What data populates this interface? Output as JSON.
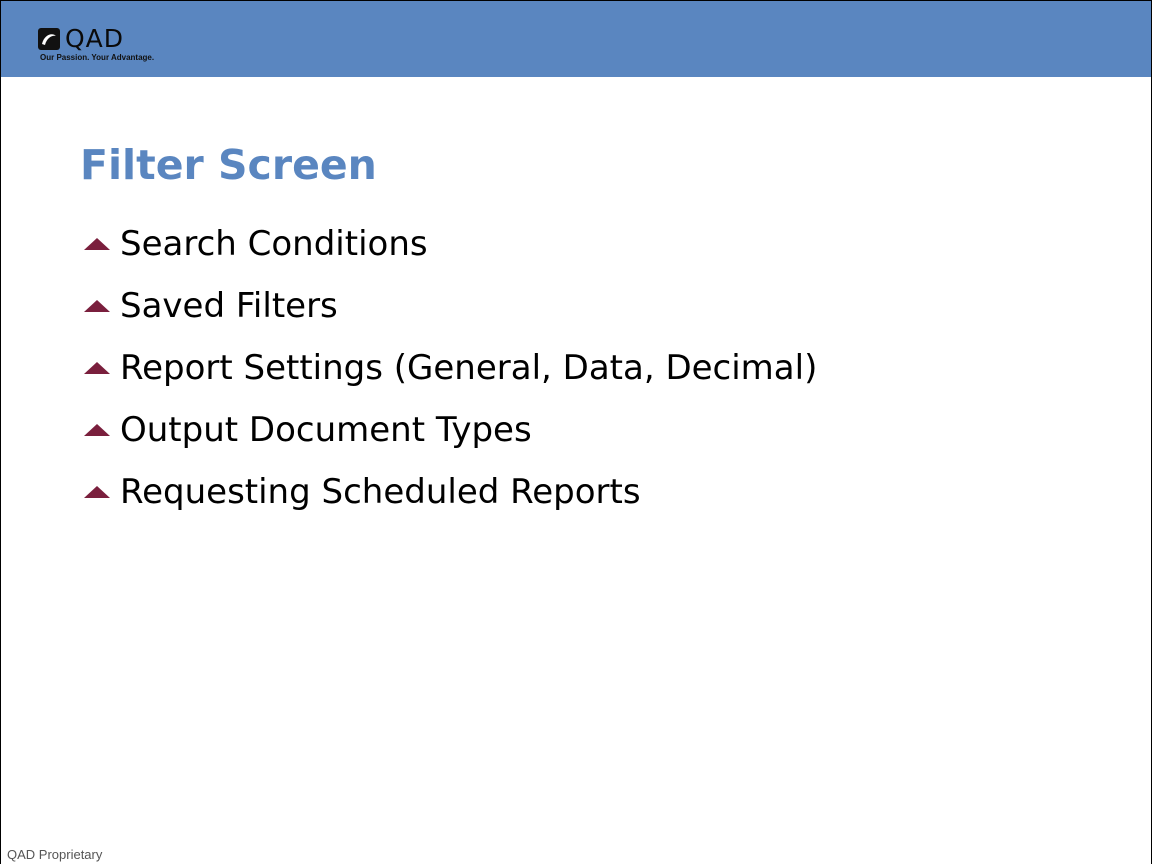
{
  "header": {
    "logo_text": "QAD",
    "logo_tagline": "Our Passion. Your Advantage."
  },
  "slide": {
    "title": "Filter Screen",
    "bullets": [
      {
        "text": "Search Conditions",
        "icon": "triangle-up-icon"
      },
      {
        "text": "Saved Filters",
        "icon": "triangle-up-icon"
      },
      {
        "text": "Report Settings (General, Data, Decimal)",
        "icon": "triangle-up-icon"
      },
      {
        "text": "Output Document Types",
        "icon": "triangle-up-icon"
      },
      {
        "text": "Requesting Scheduled Reports",
        "icon": "triangle-up-icon"
      }
    ]
  },
  "footer": {
    "text": "QAD Proprietary"
  },
  "colors": {
    "header_bg": "#5a86c0",
    "title": "#5a86c0",
    "bullet_icon": "#7a1f3d"
  }
}
